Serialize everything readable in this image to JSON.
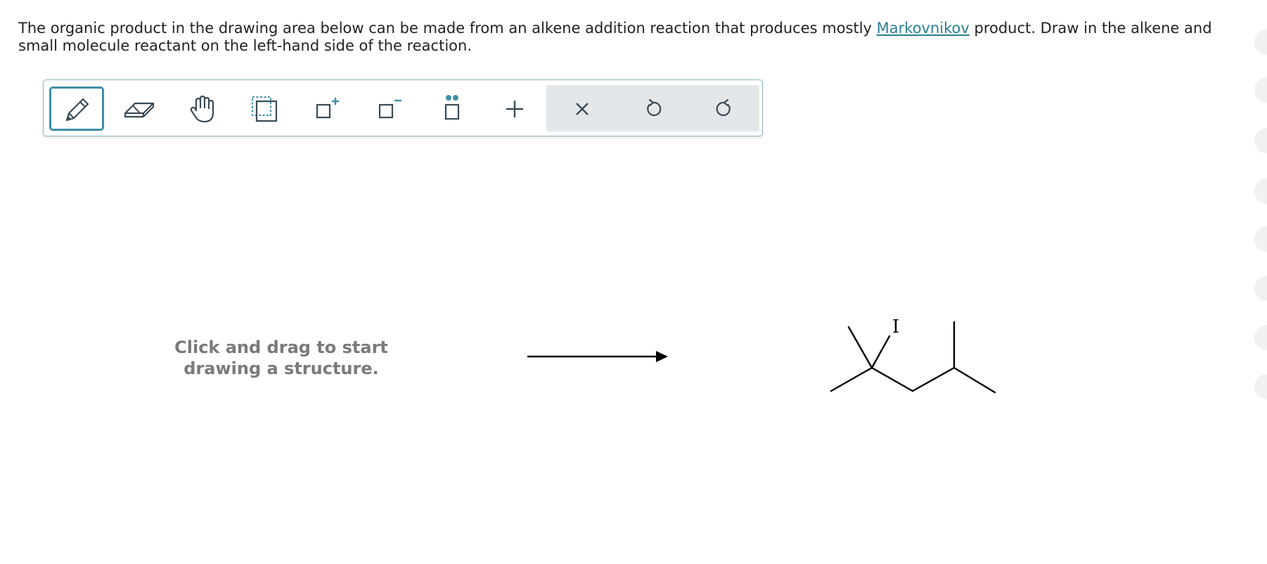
{
  "question": {
    "text_before": "The organic product in the drawing area below can be made from an alkene addition reaction that produces mostly ",
    "link_text": "Markovnikov",
    "text_after": " product. Draw in the alkene and small molecule reactant on the left-hand side of the reaction."
  },
  "toolbar": {
    "tools": [
      {
        "name": "draw",
        "icon": "pencil-icon",
        "active": true
      },
      {
        "name": "erase",
        "icon": "eraser-icon",
        "active": false
      },
      {
        "name": "move",
        "icon": "hand-icon",
        "active": false
      },
      {
        "name": "select",
        "icon": "lasso-select-icon",
        "active": false
      },
      {
        "name": "increase-charge",
        "icon": "charge-plus-icon",
        "active": false
      },
      {
        "name": "decrease-charge",
        "icon": "charge-minus-icon",
        "active": false
      },
      {
        "name": "lone-pair",
        "icon": "lone-pair-icon",
        "active": false
      },
      {
        "name": "add-reagent",
        "icon": "plus-icon",
        "active": false
      },
      {
        "name": "clear",
        "icon": "close-icon",
        "active": false
      },
      {
        "name": "undo",
        "icon": "undo-icon",
        "active": false
      },
      {
        "name": "redo",
        "icon": "redo-icon",
        "active": false
      }
    ]
  },
  "canvas": {
    "placeholder": "Click and drag to start drawing a structure.",
    "product_atom_label": "I"
  },
  "colors": {
    "accent": "#3e8fa6",
    "link": "#2a7f95",
    "icon": "#3b4a55",
    "hint": "#7a7a7a"
  }
}
